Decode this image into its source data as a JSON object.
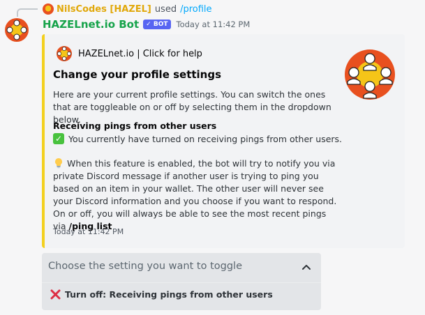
{
  "reply": {
    "user": "NilsCodes [HAZEL]",
    "used": "used",
    "command": "/profile"
  },
  "message": {
    "author": "HAZELnet.io Bot",
    "badge": "BOT",
    "timestamp": "Today at 11:42 PM"
  },
  "embed": {
    "author": "HAZELnet.io | Click for help",
    "title": "Change your profile settings",
    "description": "Here are your current profile settings. You can switch the ones that are toggleable on or off by selecting them in the dropdown below.",
    "field_name": "Receiving pings from other users",
    "field_value": "You currently have turned on receiving pings from other users.",
    "info_text": "When this feature is enabled, the bot will try to notify you via private Discord message if another user is trying to ping you based on an item in your wallet. The other user will never see your Discord information and you choose if you want to respond. On or off, you will always be able to see the most recent pings via",
    "info_command": "/ping list",
    "footer": "Today at 11:42 PM",
    "accent_color": "#f3d01f"
  },
  "select": {
    "placeholder": "Choose the setting you want to toggle",
    "option_label": "Turn off: Receiving pings from other users"
  },
  "icons": {
    "check": "white-check-mark-icon",
    "bulb": "light-bulb-icon",
    "cross": "cross-mark-icon",
    "chevron": "chevron-up-icon"
  }
}
